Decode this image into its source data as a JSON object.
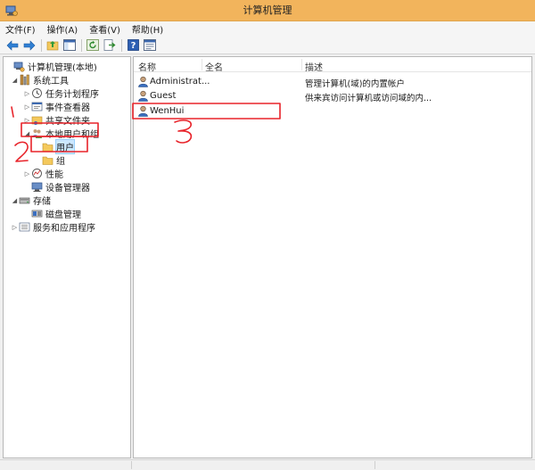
{
  "window": {
    "title": "计算机管理"
  },
  "menu": [
    {
      "label": "文件(F)"
    },
    {
      "label": "操作(A)"
    },
    {
      "label": "查看(V)"
    },
    {
      "label": "帮助(H)"
    }
  ],
  "toolbar": [
    {
      "icon": "back-arrow-icon"
    },
    {
      "icon": "forward-arrow-icon"
    },
    {
      "icon": "up-folder-icon"
    },
    {
      "icon": "show-hide-tree-icon"
    },
    {
      "icon": "refresh-icon"
    },
    {
      "icon": "export-list-icon"
    },
    {
      "icon": "help-icon"
    },
    {
      "icon": "properties-icon"
    }
  ],
  "tree": [
    {
      "label": "计算机管理(本地)",
      "icon": "computer-management-icon",
      "level": 0,
      "arrow": ""
    },
    {
      "label": "系统工具",
      "icon": "system-tools-icon",
      "level": 1,
      "arrow": "expanded"
    },
    {
      "label": "任务计划程序",
      "icon": "task-scheduler-icon",
      "level": 2,
      "arrow": "collapsed"
    },
    {
      "label": "事件查看器",
      "icon": "event-viewer-icon",
      "level": 2,
      "arrow": "collapsed"
    },
    {
      "label": "共享文件夹",
      "icon": "shared-folder-icon",
      "level": 2,
      "arrow": "collapsed"
    },
    {
      "label": "本地用户和组",
      "icon": "local-users-groups-icon",
      "level": 2,
      "arrow": "expanded"
    },
    {
      "label": "用户",
      "icon": "folder-icon",
      "level": 3,
      "arrow": "",
      "selected": true
    },
    {
      "label": "组",
      "icon": "folder-icon",
      "level": 3,
      "arrow": ""
    },
    {
      "label": "性能",
      "icon": "performance-icon",
      "level": 2,
      "arrow": "collapsed"
    },
    {
      "label": "设备管理器",
      "icon": "device-manager-icon",
      "level": 2,
      "arrow": ""
    },
    {
      "label": "存储",
      "icon": "storage-icon",
      "level": 1,
      "arrow": "expanded"
    },
    {
      "label": "磁盘管理",
      "icon": "disk-management-icon",
      "level": 2,
      "arrow": ""
    },
    {
      "label": "服务和应用程序",
      "icon": "services-apps-icon",
      "level": 1,
      "arrow": "collapsed"
    }
  ],
  "list": {
    "columns": [
      "名称",
      "全名",
      "描述"
    ],
    "rows": [
      {
        "name": "Administrat...",
        "fullname": "",
        "description": "管理计算机(域)的内置帐户"
      },
      {
        "name": "Guest",
        "fullname": "",
        "description": "供来宾访问计算机或访问域的内..."
      },
      {
        "name": "WenHui",
        "fullname": "",
        "description": ""
      }
    ]
  },
  "annotations": {
    "color": "#e8232a",
    "marks": [
      "1",
      "2",
      "3"
    ]
  }
}
